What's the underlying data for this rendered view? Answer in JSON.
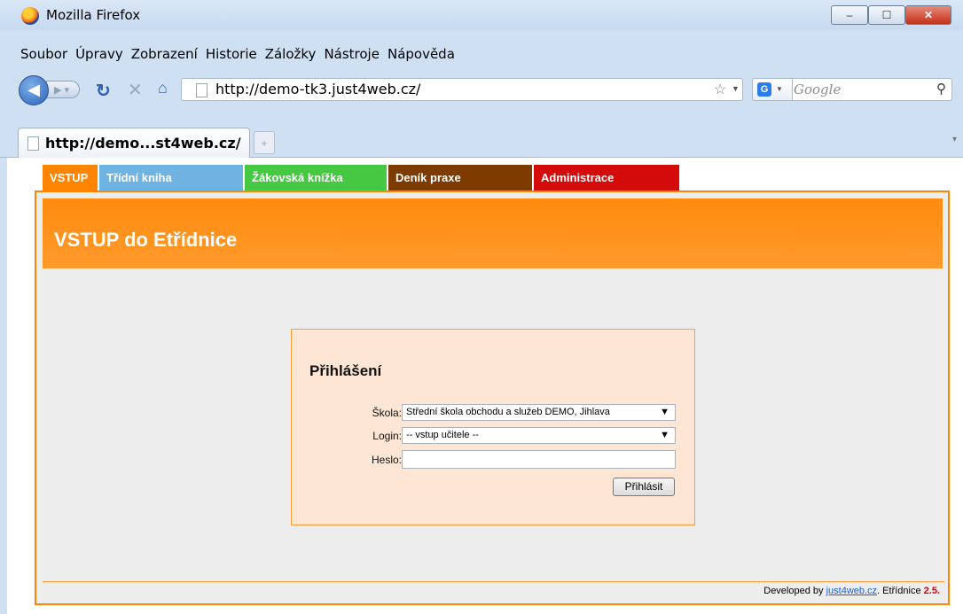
{
  "window": {
    "title": "Mozilla Firefox",
    "minimize_glyph": "–",
    "maximize_glyph": "☐",
    "close_glyph": "✕"
  },
  "menu": [
    "Soubor",
    "Úpravy",
    "Zobrazení",
    "Historie",
    "Záložky",
    "Nástroje",
    "Nápověda"
  ],
  "toolbar": {
    "url": "http://demo-tk3.just4web.cz/",
    "search_placeholder": "Google",
    "search_engine_icon": "G"
  },
  "tabs": [
    {
      "label": "http://demo...st4web.cz/",
      "active": true
    }
  ],
  "site": {
    "nav": [
      {
        "label": "VSTUP",
        "color": "#ff8400"
      },
      {
        "label": "Třídní kniha",
        "color": "#6fb3e2"
      },
      {
        "label": "Žákovská knížka",
        "color": "#47c843"
      },
      {
        "label": "Deník praxe",
        "color": "#7d3b00"
      },
      {
        "label": "Administrace",
        "color": "#d30b0b"
      }
    ],
    "banner_title": "VSTUP do Etřídnice",
    "login": {
      "title": "Přihlášení",
      "school_label": "Škola:",
      "school_value": "Střední škola obchodu a služeb DEMO, Jihlava",
      "login_label": "Login:",
      "login_value": "-- vstup učitele --",
      "password_label": "Heslo:",
      "password_value": "",
      "submit": "Přihlásit"
    },
    "footer": {
      "prefix": "Developed by ",
      "link": "just4web.cz",
      "suffix": ". Etřídnice ",
      "version": "2.5."
    }
  }
}
